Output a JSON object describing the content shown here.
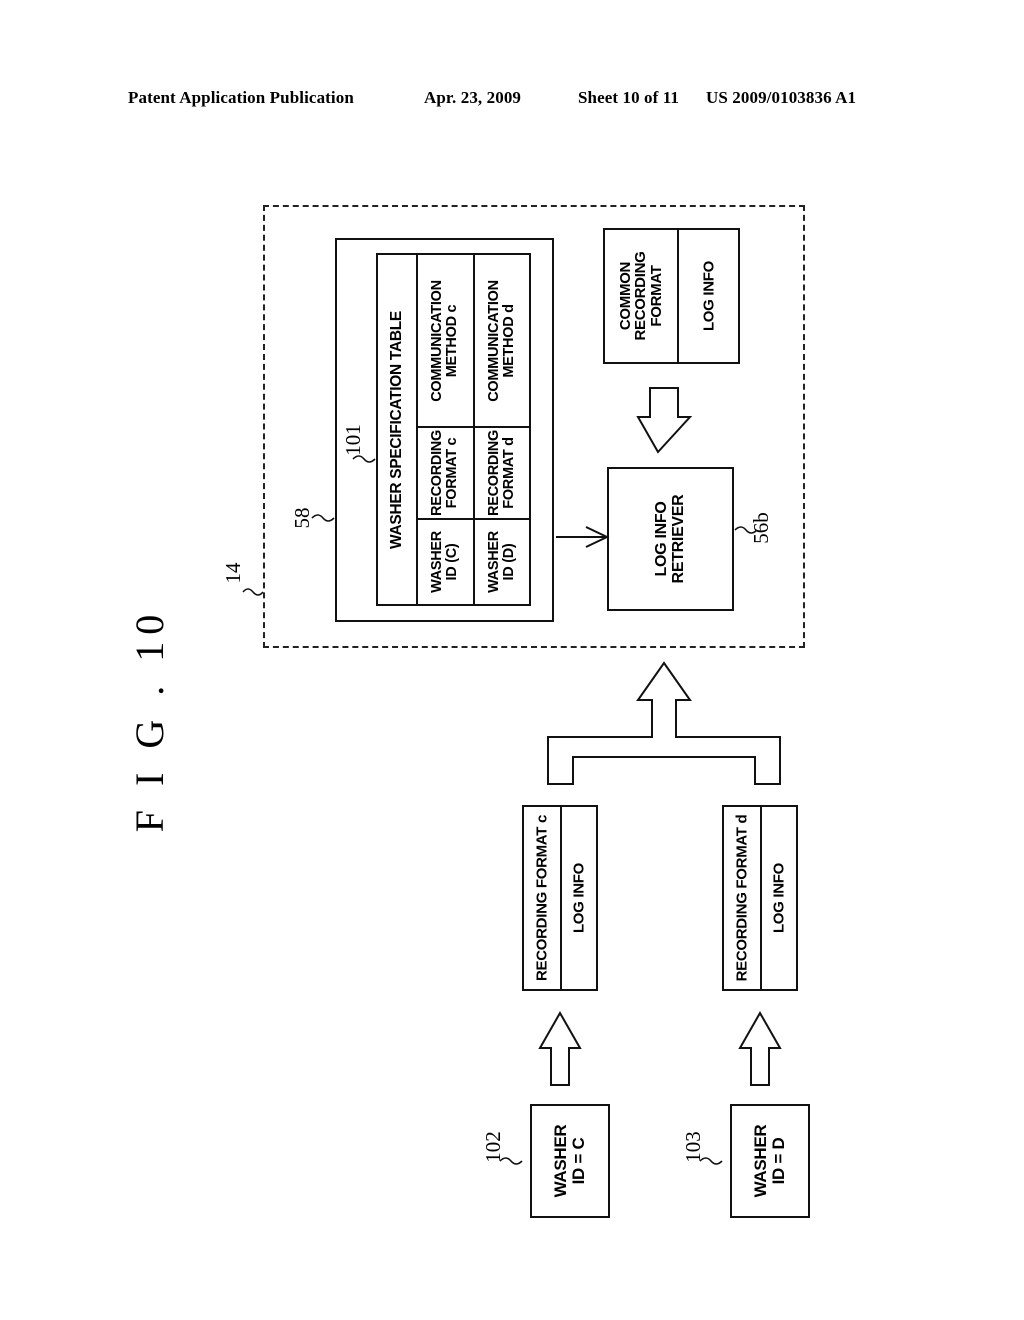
{
  "header": {
    "publication": "Patent Application Publication",
    "date": "Apr. 23, 2009",
    "sheet": "Sheet 10 of 11",
    "patent_number": "US 2009/0103836 A1"
  },
  "figure": {
    "label": "F I G . 10"
  },
  "diagram": {
    "dashed_container_ref": "14",
    "storage_unit_ref": "58",
    "spec_table": {
      "ref": "101",
      "title": "WASHER SPECIFICATION TABLE",
      "rows": [
        {
          "washer_id": "WASHER\nID (C)",
          "recording_format": "RECORDING\nFORMAT c",
          "communication_method": "COMMUNICATION\nMETHOD c"
        },
        {
          "washer_id": "WASHER\nID (D)",
          "recording_format": "RECORDING\nFORMAT d",
          "communication_method": "COMMUNICATION\nMETHOD d"
        }
      ]
    },
    "retriever": {
      "ref": "56b",
      "label": "LOG INFO\nRETRIEVER"
    },
    "common_output": {
      "format_label": "COMMON\nRECORDING\nFORMAT",
      "log_label": "LOG INFO"
    },
    "packets": [
      {
        "format_label": "RECORDING FORMAT c",
        "log_label": "LOG INFO"
      },
      {
        "format_label": "RECORDING FORMAT d",
        "log_label": "LOG INFO"
      }
    ],
    "washers": [
      {
        "ref": "102",
        "label": "WASHER\nID = C"
      },
      {
        "ref": "103",
        "label": "WASHER\nID = D"
      }
    ]
  }
}
